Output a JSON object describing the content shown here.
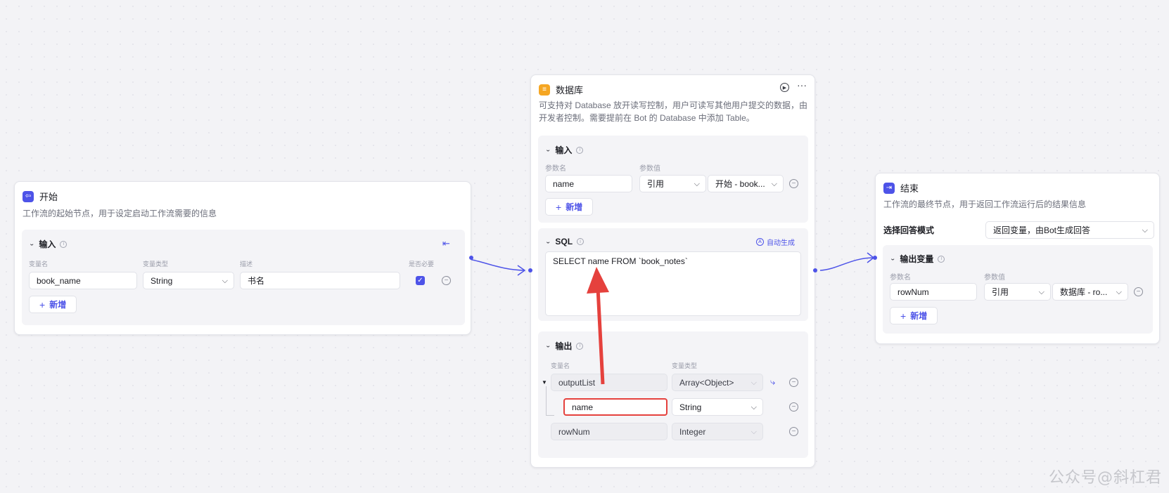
{
  "start_node": {
    "title": "开始",
    "description": "工作流的起始节点，用于设定启动工作流需要的信息",
    "input_section": {
      "title": "输入",
      "columns": [
        "变量名",
        "变量类型",
        "描述",
        "是否必要"
      ],
      "row": {
        "name": "book_name",
        "type": "String",
        "desc": "书名",
        "required": true
      },
      "add_label": "新增"
    }
  },
  "db_node": {
    "title": "数据库",
    "description": "可支持对 Database 放开读写控制，用户可读写其他用户提交的数据，由开发者控制。需要提前在 Bot 的 Database 中添加 Table。",
    "input_section": {
      "title": "输入",
      "columns": [
        "参数名",
        "参数值"
      ],
      "row": {
        "name": "name",
        "source": "引用",
        "value": "开始 - book..."
      },
      "add_label": "新增"
    },
    "sql_section": {
      "title": "SQL",
      "auto_label": "自动生成",
      "query": "SELECT name FROM `book_notes`"
    },
    "output_section": {
      "title": "输出",
      "columns": [
        "变量名",
        "变量类型"
      ],
      "rows": [
        {
          "name": "outputList",
          "type": "Array<Object>"
        },
        {
          "name": "name",
          "type": "String"
        },
        {
          "name": "rowNum",
          "type": "Integer"
        }
      ]
    }
  },
  "end_node": {
    "title": "结束",
    "description": "工作流的最终节点，用于返回工作流运行后的结果信息",
    "mode_label": "选择回答模式",
    "mode_value": "返回变量，由Bot生成回答",
    "output_section": {
      "title": "输出变量",
      "columns": [
        "参数名",
        "参数值"
      ],
      "row": {
        "name": "rowNum",
        "source": "引用",
        "value": "数据库 - ro..."
      },
      "add_label": "新增"
    }
  },
  "watermark": "公众号@斜杠君",
  "colors": {
    "accent": "#4d53e8",
    "annotation": "#e5413d",
    "db_icon": "#f5a623"
  },
  "icons": [
    "exit-icon",
    "database-icon",
    "play-icon",
    "more-icon",
    "dropdown-icon",
    "remove-icon",
    "branch-icon",
    "magic-icon"
  ]
}
